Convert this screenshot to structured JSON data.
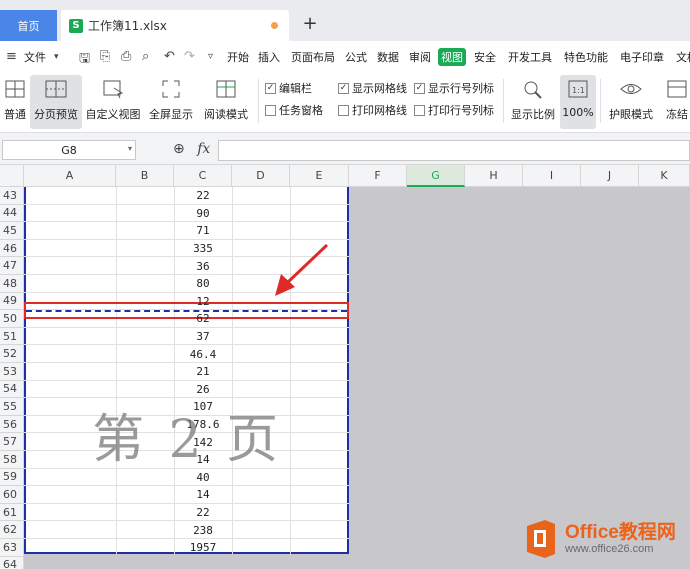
{
  "tabs": {
    "home": "首页",
    "file": "工作簿11.xlsx",
    "add": "+"
  },
  "menu": {
    "file": "文件",
    "items": [
      "开始",
      "插入",
      "页面布局",
      "公式",
      "数据",
      "审阅",
      "视图",
      "安全",
      "开发工具",
      "特色功能",
      "电子印章",
      "文档"
    ],
    "active": "视图"
  },
  "ribbon": {
    "normal": "普通",
    "page_break_preview": "分页预览",
    "custom_view": "自定义视图",
    "full_screen": "全屏显示",
    "reading_mode": "阅读模式",
    "checkboxes": [
      {
        "label": "编辑栏",
        "checked": true
      },
      {
        "label": "任务窗格",
        "checked": false
      },
      {
        "label": "显示网格线",
        "checked": true
      },
      {
        "label": "打印网格线",
        "checked": false
      },
      {
        "label": "显示行号列标",
        "checked": true
      },
      {
        "label": "打印行号列标",
        "checked": false
      }
    ],
    "zoom_ratio": "显示比例",
    "zoom_100": "100%",
    "eye_protect": "护眼模式",
    "freeze": "冻结"
  },
  "formula_bar": {
    "name_box": "G8",
    "fx": "fx",
    "value": ""
  },
  "grid": {
    "columns": [
      "A",
      "B",
      "C",
      "D",
      "E",
      "F",
      "G",
      "H",
      "I",
      "J",
      "K"
    ],
    "selected_column": "G",
    "rows": [
      "43",
      "44",
      "45",
      "46",
      "47",
      "48",
      "49",
      "50",
      "51",
      "52",
      "53",
      "54",
      "55",
      "56",
      "57",
      "58",
      "59",
      "60",
      "61",
      "62",
      "63",
      "64"
    ],
    "c_values": [
      "22",
      "90",
      "71",
      "335",
      "36",
      "80",
      "12",
      "62",
      "37",
      "46.4",
      "21",
      "26",
      "107",
      "178.6",
      "142",
      "14",
      "40",
      "14",
      "22",
      "238",
      "1957",
      ""
    ],
    "watermark": "第 2 页"
  },
  "logo": {
    "title": "Office教程网",
    "url": "www.office26.com"
  },
  "colors": {
    "accent": "#1aaa55",
    "home_tab": "#4a86e8",
    "page_border": "#1c2ea8",
    "highlight": "#e02a2a"
  }
}
